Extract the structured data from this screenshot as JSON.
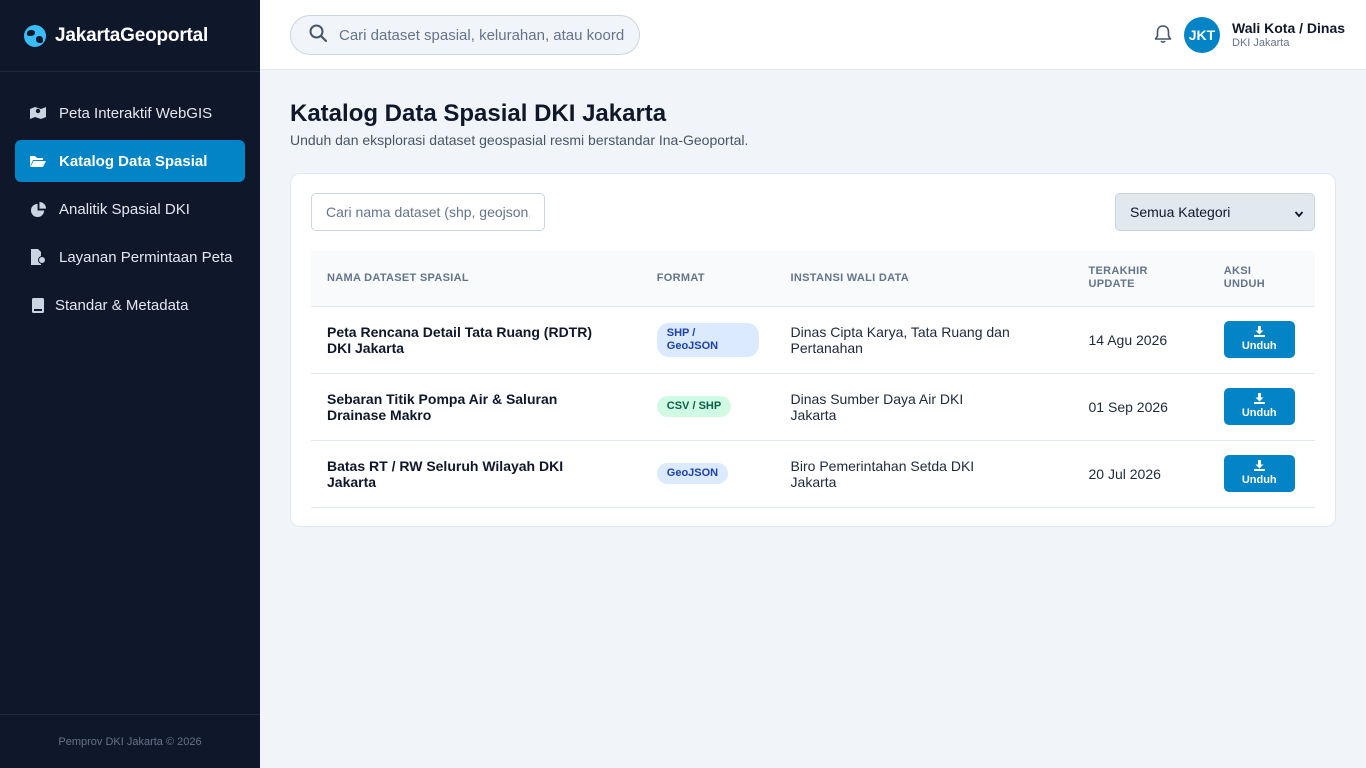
{
  "app": {
    "brand": "JakartaGeoportal"
  },
  "sidebar": {
    "items": [
      {
        "label": "Peta Interaktif WebGIS",
        "icon": "map-icon",
        "active": false
      },
      {
        "label": "Katalog Data Spasial",
        "icon": "folder-open-icon",
        "active": true
      },
      {
        "label": "Analitik Spasial DKI",
        "icon": "pie-chart-icon",
        "active": false
      },
      {
        "label": "Layanan Permintaan Peta",
        "icon": "file-icon",
        "active": false
      },
      {
        "label": "Standar & Metadata",
        "icon": "book-icon",
        "active": false
      }
    ],
    "footer": "Pemprov DKI Jakarta © 2026"
  },
  "header": {
    "search_placeholder": "Cari dataset spasial, kelurahan, atau koordinat...",
    "avatar_initials": "JKT",
    "user_name": "Wali Kota / Dinas",
    "user_org": "DKI Jakarta"
  },
  "main": {
    "title": "Katalog Data Spasial DKI Jakarta",
    "subtitle": "Unduh dan eksplorasi dataset geospasial resmi berstandar Ina-Geoportal.",
    "filter_placeholder": "Cari nama dataset (shp, geojson, csv)...",
    "category_select": "Semua Kategori",
    "table": {
      "headers": [
        "NAMA DATASET SPASIAL",
        "FORMAT",
        "INSTANSI WALI DATA",
        "TERAKHIR UPDATE",
        "AKSI UNDUH"
      ],
      "rows": [
        {
          "name": "Peta Rencana Detail Tata Ruang (RDTR) DKI Jakarta",
          "format": "SHP / GeoJSON",
          "format_color": "blue",
          "agency": "Dinas Cipta Karya, Tata Ruang dan Pertanahan",
          "updated": "14 Agu 2026",
          "action": "Unduh"
        },
        {
          "name": "Sebaran Titik Pompa Air & Saluran Drainase Makro",
          "format": "CSV / SHP",
          "format_color": "green",
          "agency": "Dinas Sumber Daya Air DKI Jakarta",
          "updated": "01 Sep 2026",
          "action": "Unduh"
        },
        {
          "name": "Batas RT / RW Seluruh Wilayah DKI Jakarta",
          "format": "GeoJSON",
          "format_color": "blue",
          "agency": "Biro Pemerintahan Setda DKI Jakarta",
          "updated": "20 Jul 2026",
          "action": "Unduh"
        }
      ]
    }
  },
  "colors": {
    "sidebar_bg": "#0f172a",
    "accent": "#0284c7",
    "page_bg": "#f1f5f9"
  }
}
